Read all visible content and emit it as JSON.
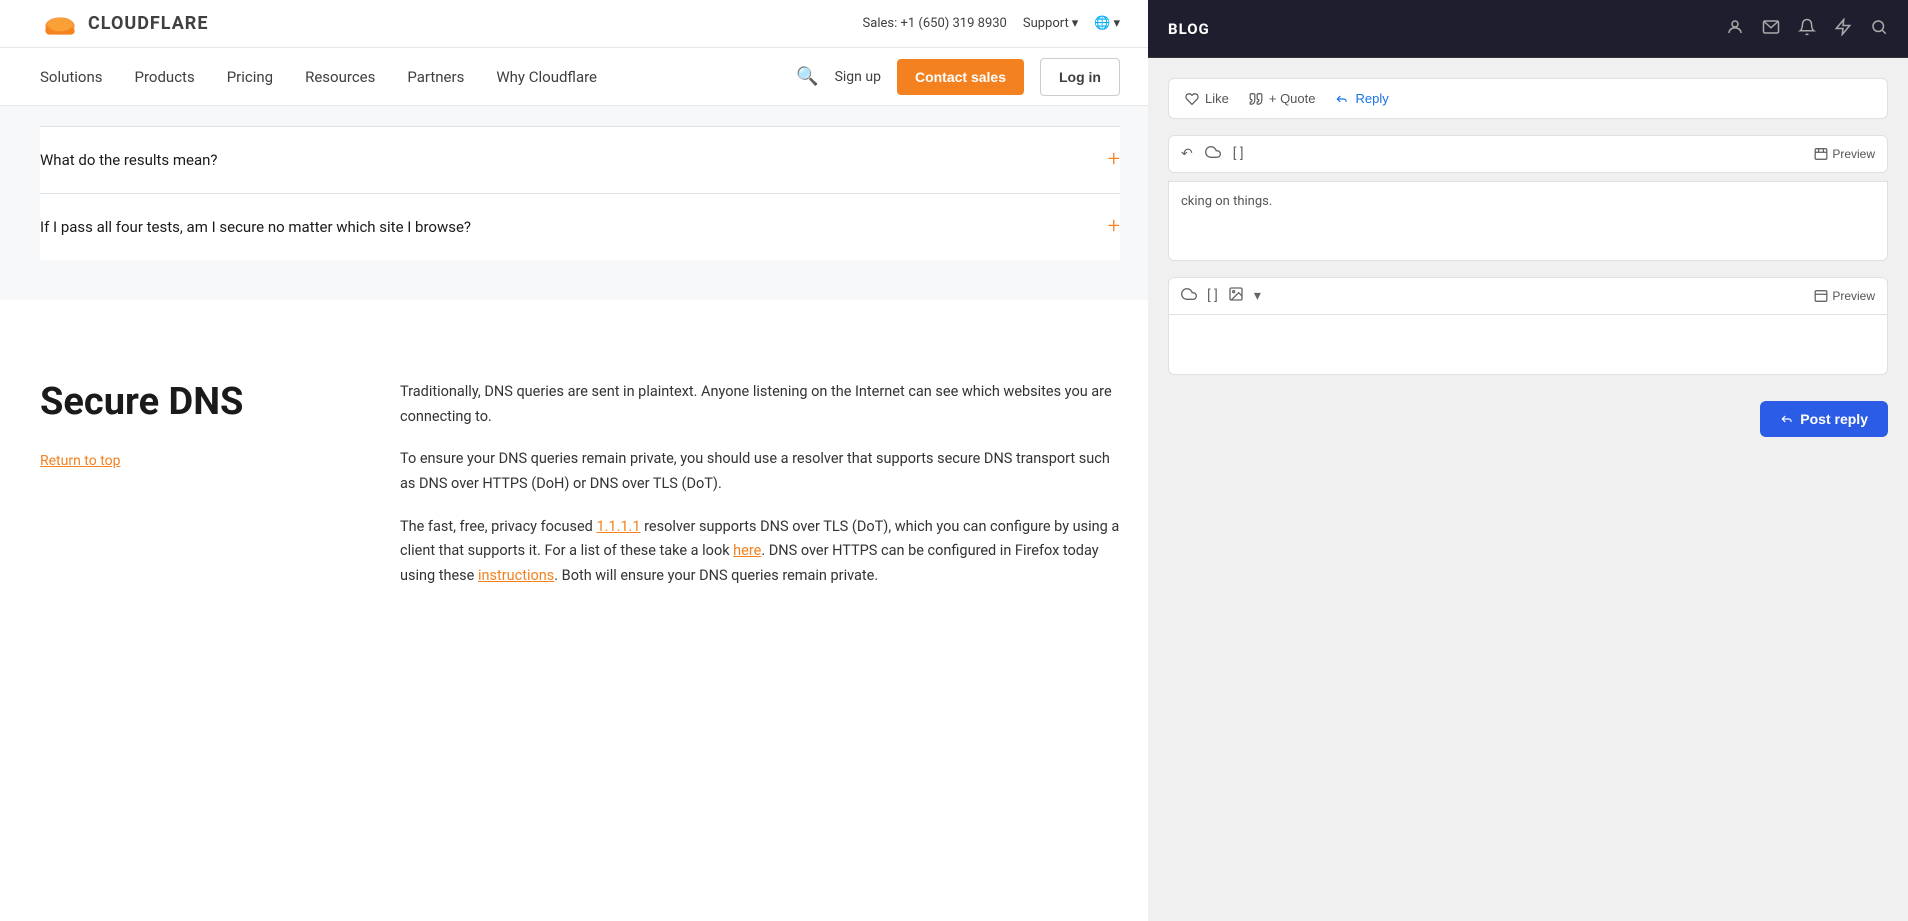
{
  "cloudflare": {
    "topbar": {
      "logo_text": "CLOUDFLARE",
      "phone": "Sales: +1 (650) 319 8930",
      "support": "Support",
      "support_chevron": "▾",
      "globe_icon": "🌐",
      "globe_chevron": "▾"
    },
    "navbar": {
      "links": [
        {
          "label": "Solutions"
        },
        {
          "label": "Products"
        },
        {
          "label": "Pricing"
        },
        {
          "label": "Resources"
        },
        {
          "label": "Partners"
        },
        {
          "label": "Why Cloudflare"
        }
      ],
      "signup_label": "Sign up",
      "contact_label": "Contact sales",
      "login_label": "Log in"
    },
    "faq": {
      "items": [
        {
          "question": "What do the results mean?",
          "plus": "+"
        },
        {
          "question": "If I pass all four tests, am I secure no matter which site I browse?",
          "plus": "+"
        }
      ]
    },
    "secure_dns": {
      "title": "Secure DNS",
      "return_link": "Return to top",
      "paragraphs": [
        "Traditionally, DNS queries are sent in plaintext. Anyone listening on the Internet can see which websites you are connecting to.",
        "To ensure your DNS queries remain private, you should use a resolver that supports secure DNS transport such as DNS over HTTPS (DoH) or DNS over TLS (DoT).",
        "The fast, free, privacy focused 1.1.1.1 resolver supports DNS over TLS (DoT), which you can configure by using a client that supports it. For a list of these take a look here. DNS over HTTPS can be configured in Firefox today using these instructions. Both will ensure your DNS queries remain private."
      ],
      "link_1111": "1.1.1.1",
      "link_here": "here",
      "link_instructions": "instructions"
    }
  },
  "blog": {
    "header": {
      "title": "BLOG",
      "icons": {
        "user": "👤",
        "mail": "✉",
        "bell": "🔔",
        "bolt": "⚡",
        "search": "🔍"
      }
    },
    "post_actions": {
      "like_label": "Like",
      "quote_label": "+ Quote",
      "reply_label": "Reply"
    },
    "editor1": {
      "toolbar_icons": [
        "↶",
        "☁",
        "[ ]",
        "📄"
      ],
      "preview_label": "Preview",
      "body_text": "cking on things."
    },
    "editor2": {
      "toolbar_icons": [
        "☁",
        "[ ]",
        "🖼"
      ],
      "preview_label": "Preview",
      "body_text": ""
    },
    "post_reply": {
      "label": "Post reply"
    }
  }
}
